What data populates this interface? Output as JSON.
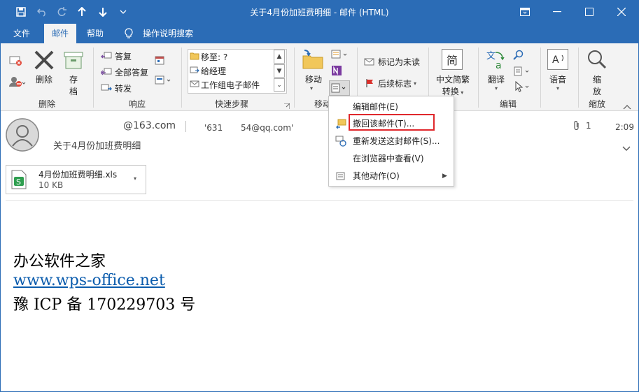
{
  "window": {
    "title": "关于4月份加班费明细  -  邮件 (HTML)"
  },
  "quick_access": [
    "save-icon",
    "undo-icon",
    "redo-icon",
    "up-icon",
    "down-icon",
    "customize-icon"
  ],
  "tabs": [
    {
      "label": "文件"
    },
    {
      "label": "邮件"
    },
    {
      "label": "帮助"
    }
  ],
  "tell_me": {
    "label": "操作说明搜索"
  },
  "ribbon": {
    "delete_group": {
      "delete_label": "删除",
      "archive_label_1": "存",
      "archive_label_2": "档",
      "group_label": "删除"
    },
    "respond_group": {
      "reply": "答复",
      "reply_all": "全部答复",
      "forward": "转发",
      "group_label": "响应"
    },
    "quicksteps_group": {
      "items": [
        "移至: ?",
        "给经理",
        "工作组电子邮件"
      ],
      "group_label": "快速步骤"
    },
    "move_group": {
      "move_label": "移动",
      "group_label": "移动"
    },
    "tags_group": {
      "mark_unread": "标记为未读",
      "follow_up": "后续标志"
    },
    "chinese_group": {
      "icon_text": "简",
      "label_1": "中文简繁",
      "label_2": "转换"
    },
    "edit_group": {
      "translate": "翻译",
      "group_label": "编辑"
    },
    "speech_group": {
      "label": "语音"
    },
    "zoom_group": {
      "label_1": "缩",
      "label_2": "放",
      "group_label": "缩放"
    }
  },
  "header": {
    "from": "@163.com",
    "to": "'631",
    "to2": "54@qq.com'",
    "subject": "关于4月份加班费明细",
    "attachment_count": "1",
    "time": "2:09"
  },
  "attachment": {
    "name": "4月份加班费明细.xls",
    "size": "10 KB"
  },
  "body": {
    "line1": "办公软件之家",
    "link": "www.wps-office.net",
    "line3": "豫 ICP 备 170229703 号"
  },
  "context_menu": {
    "items": [
      {
        "label": "编辑邮件(E)"
      },
      {
        "label": "撤回该邮件(T)..."
      },
      {
        "label": "重新发送这封邮件(S)..."
      },
      {
        "label": "在浏览器中查看(V)"
      },
      {
        "label": "其他动作(O)"
      }
    ]
  },
  "colors": {
    "accent": "#2b6cb6",
    "highlight_box": "#e0282c",
    "link": "#0b5cad"
  }
}
